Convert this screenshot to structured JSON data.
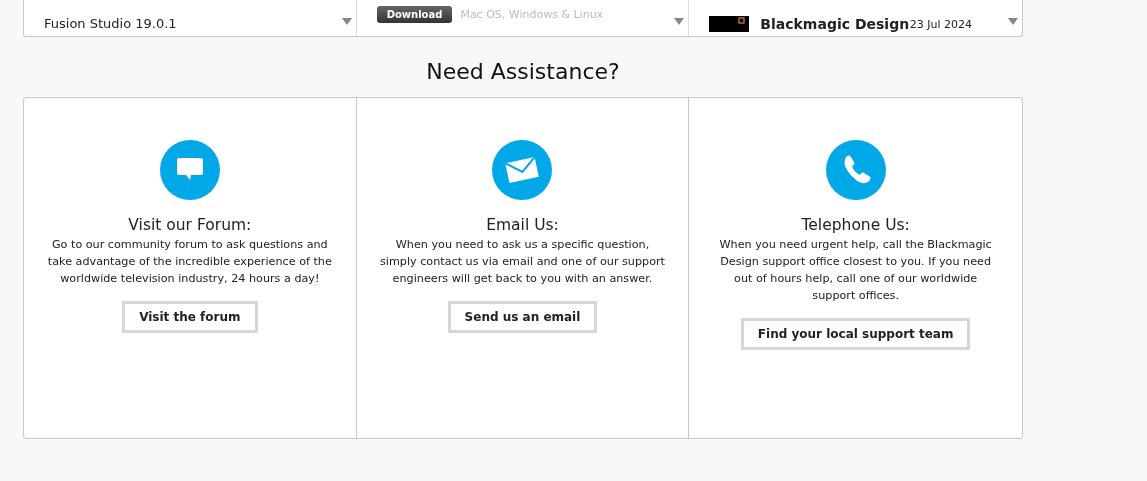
{
  "downloads": [
    {
      "kind": "update",
      "title": "Fusion Studio 19.0.1"
    },
    {
      "kind": "download",
      "button": "Download",
      "platforms": "Mac OS, Windows & Linux"
    },
    {
      "kind": "news",
      "source": "Blackmagic Design",
      "date": "23 Jul 2024"
    }
  ],
  "assistance": {
    "heading": "Need Assistance?",
    "cards": [
      {
        "kind": "chat",
        "title": "Visit our Forum:",
        "text": "Go to our community forum to ask questions and take advantage of the incredible experience of the worldwide television industry, 24 hours a day!",
        "button": "Visit the forum"
      },
      {
        "kind": "mail",
        "title": "Email Us:",
        "text": "When you need to ask us a specific question, simply contact us via email and one of our support engineers will get back to you with an answer.",
        "button": "Send us an email"
      },
      {
        "kind": "phone",
        "title": "Telephone Us:",
        "text": "When you need urgent help, call the Blackmagic Design support office closest to you. If you need out of hours help, call one of our worldwide support offices.",
        "button": "Find your local support team"
      }
    ]
  }
}
